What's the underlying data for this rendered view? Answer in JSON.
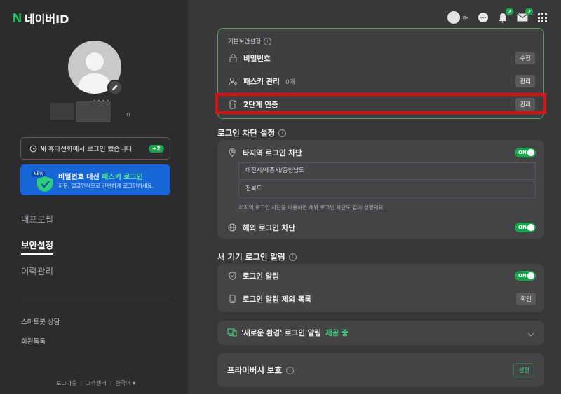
{
  "logo": {
    "mark": "N",
    "title": "네이버ID"
  },
  "profile": {
    "name_dots": "••••",
    "name_suffix": "n"
  },
  "notice": {
    "text": "새 휴대전화에서 로그인 했습니다",
    "badge": "+2"
  },
  "passkey_banner": {
    "new_tag": "NEW",
    "title_prefix": "비밀번호 대신 ",
    "title_highlight": "패스키 로그인",
    "subtitle": "지문, 얼굴인식으로 간편하게 로그인하세요."
  },
  "nav": {
    "items": [
      {
        "label": "내프로필"
      },
      {
        "label": "보안설정"
      },
      {
        "label": "이력관리"
      }
    ]
  },
  "sub_nav": {
    "items": [
      {
        "label": "스마트봇 상담"
      },
      {
        "label": "회원톡톡"
      }
    ]
  },
  "footer": {
    "logout": "로그아웃",
    "help": "고객센터",
    "lang": "한국어"
  },
  "header": {
    "lang_icon": "⊡▾",
    "notify_count": "2",
    "mail_count": "2"
  },
  "basic_security": {
    "label": "기본보안설정",
    "password": {
      "label": "비밀번호",
      "action": "수정"
    },
    "passkey": {
      "label": "패스키 관리",
      "count": "0개",
      "action": "관리"
    },
    "two_step": {
      "label": "2단계 인증",
      "action": "관리"
    }
  },
  "login_block": {
    "title": "로그인 차단 설정",
    "region_block": {
      "label": "타지역 로그인 차단",
      "toggle": "ON"
    },
    "regions": [
      "대전시/세종시/충청남도",
      "전북도"
    ],
    "note": "타지역 로그인 차단을 이용하면 해외 로그인 차단도 같이 실행돼요.",
    "overseas_block": {
      "label": "해외 로그인 차단",
      "toggle": "ON"
    }
  },
  "new_device": {
    "title": "새 기기 로그인 알림",
    "login_alert": {
      "label": "로그인 알림",
      "toggle": "ON"
    },
    "exclude_list": {
      "label": "로그인 알림 제외 목록",
      "action": "확인"
    }
  },
  "new_env": {
    "label": "'새로운 환경' 로그인 알림",
    "status": "제공 중"
  },
  "privacy": {
    "label": "프라이버시 보호",
    "action": "설정"
  },
  "colors": {
    "accent": "#19a34a",
    "highlight": "#e01010",
    "banner": "#1766d8"
  }
}
